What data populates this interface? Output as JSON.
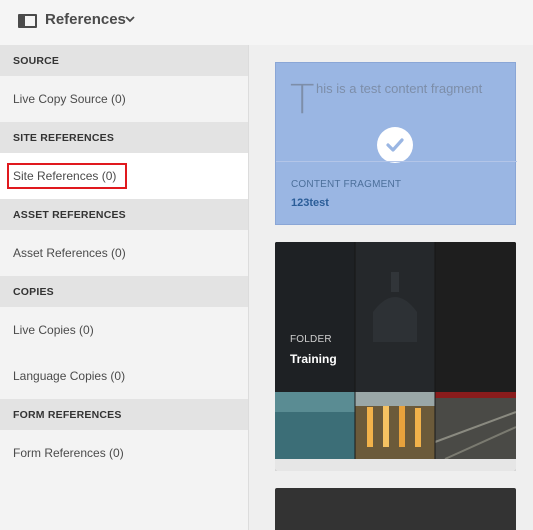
{
  "header": {
    "title": "References",
    "rail_icon": "rail-toggle-icon",
    "dropdown_icon": "chevron-down-icon"
  },
  "sidebar": {
    "sections": [
      {
        "heading": "SOURCE",
        "items": [
          {
            "label": "Live Copy Source (0)"
          }
        ]
      },
      {
        "heading": "SITE REFERENCES",
        "items": [
          {
            "label": "Site References (0)",
            "selected": true
          }
        ]
      },
      {
        "heading": "ASSET REFERENCES",
        "items": [
          {
            "label": "Asset References (0)"
          }
        ]
      },
      {
        "heading": "COPIES",
        "items": [
          {
            "label": "Live Copies (0)"
          },
          {
            "label": "Language Copies (0)"
          }
        ]
      },
      {
        "heading": "FORM REFERENCES",
        "items": [
          {
            "label": "Form References (0)"
          }
        ]
      }
    ]
  },
  "cards": [
    {
      "preview_letter": "T",
      "preview_text": "his is a test content fragment",
      "type": "CONTENT FRAGMENT",
      "name": "123test",
      "selected": true,
      "selected_icon": "checkmark-icon",
      "color": "#9ab6e3"
    },
    {
      "type": "FOLDER",
      "name": "Training"
    }
  ],
  "colors": {
    "selection_outline": "#e0191e",
    "card_selected_bg": "#9ab6e3",
    "folder_name": "#ffffff"
  }
}
